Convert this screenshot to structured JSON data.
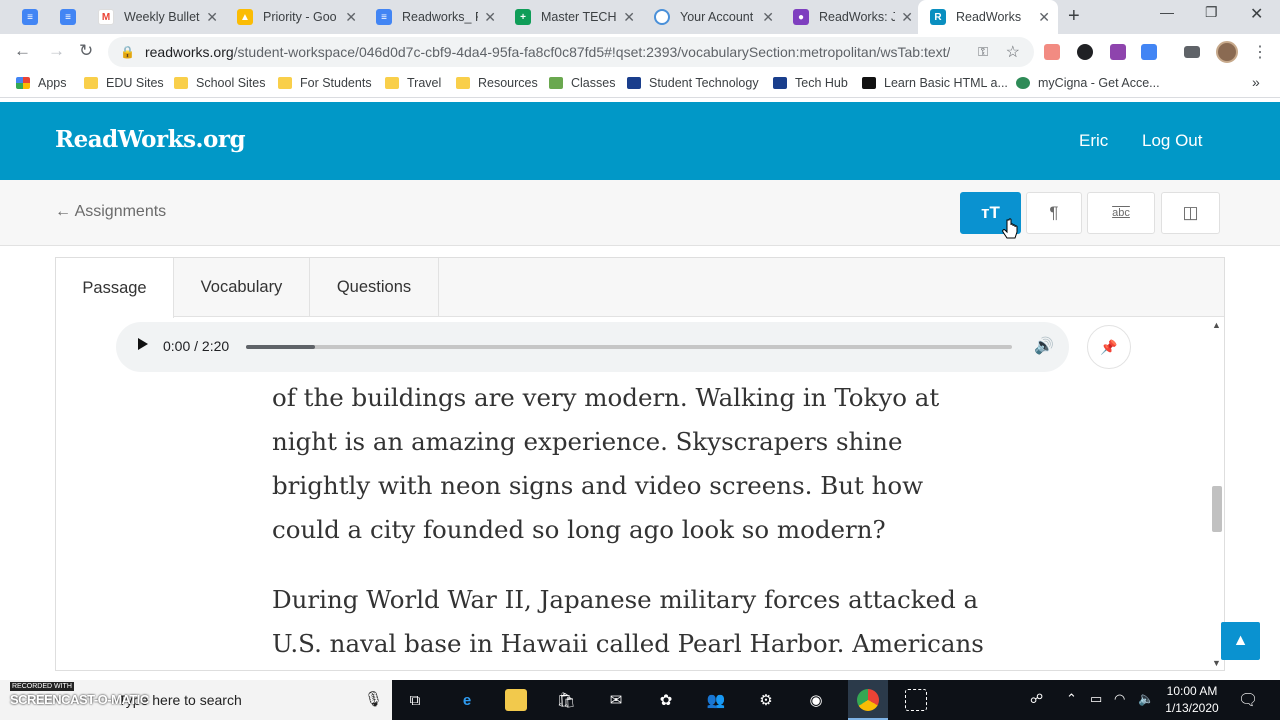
{
  "browser": {
    "tabs": [
      {
        "title": "",
        "icon": "google-docs-icon",
        "color": "#4285f4"
      },
      {
        "title": "",
        "icon": "google-docs-icon",
        "color": "#4285f4"
      },
      {
        "title": "Weekly Bulleti",
        "icon": "gmail-icon",
        "color": "#ea4335"
      },
      {
        "title": "Priority - Goo",
        "icon": "google-drive-icon",
        "color": "#fbbc04"
      },
      {
        "title": "Readworks_ F",
        "icon": "google-docs-icon",
        "color": "#4285f4"
      },
      {
        "title": "Master TECH S",
        "icon": "google-sheets-icon",
        "color": "#0f9d58"
      },
      {
        "title": "Your Account",
        "icon": "account-icon",
        "color": "#4a90d9"
      },
      {
        "title": "ReadWorks: Ja",
        "icon": "classroom-icon",
        "color": "#7e3fbf"
      },
      {
        "title": "ReadWorks",
        "icon": "readworks-icon",
        "color": "#0a8fc0"
      }
    ],
    "url_host": "readworks.org",
    "url_path": "/student-workspace/046d0d7c-cbf9-4da4-95fa-fa8cf0c87fd5#!qset:2393/vocabularySection:metropolitan/wsTab:text/",
    "bookmarks": [
      {
        "label": "Apps",
        "icon": "apps-grid-icon"
      },
      {
        "label": "EDU Sites",
        "icon": "folder-icon"
      },
      {
        "label": "School Sites",
        "icon": "folder-icon"
      },
      {
        "label": "For Students",
        "icon": "folder-icon"
      },
      {
        "label": "Travel",
        "icon": "folder-icon"
      },
      {
        "label": "Resources",
        "icon": "folder-icon"
      },
      {
        "label": "Classes",
        "icon": "classes-icon"
      },
      {
        "label": "Student Technology",
        "icon": "l-logo-icon"
      },
      {
        "label": "Tech Hub",
        "icon": "l-logo-icon"
      },
      {
        "label": "Learn Basic HTML a...",
        "icon": "codecademy-icon"
      },
      {
        "label": "myCigna - Get Acce...",
        "icon": "cigna-icon"
      }
    ]
  },
  "site": {
    "logo": "ReadWorks.org",
    "user": "Eric",
    "logout": "Log Out",
    "back": "← Assignments",
    "brand_color": "#0198c7"
  },
  "content_tabs": [
    "Passage",
    "Vocabulary",
    "Questions"
  ],
  "audio": {
    "time": "0:00 / 2:20",
    "progress": 0.09
  },
  "passage": {
    "paragraphs": [
      "of the buildings are very modern. Walking in Tokyo at night is an amazing experience. Skyscrapers shine brightly with neon signs and video screens. But how could a city founded so long ago look so modern?",
      "During World War II, Japanese military forces attacked a U.S. naval base in Hawaii called Pearl Harbor. Americans"
    ]
  },
  "taskbar": {
    "search_placeholder": "Type here to search",
    "recorder_label": "RECORDED WITH",
    "recorder_name": "SCREENCAST-O-MATIC",
    "time": "10:00 AM",
    "date": "1/13/2020"
  }
}
